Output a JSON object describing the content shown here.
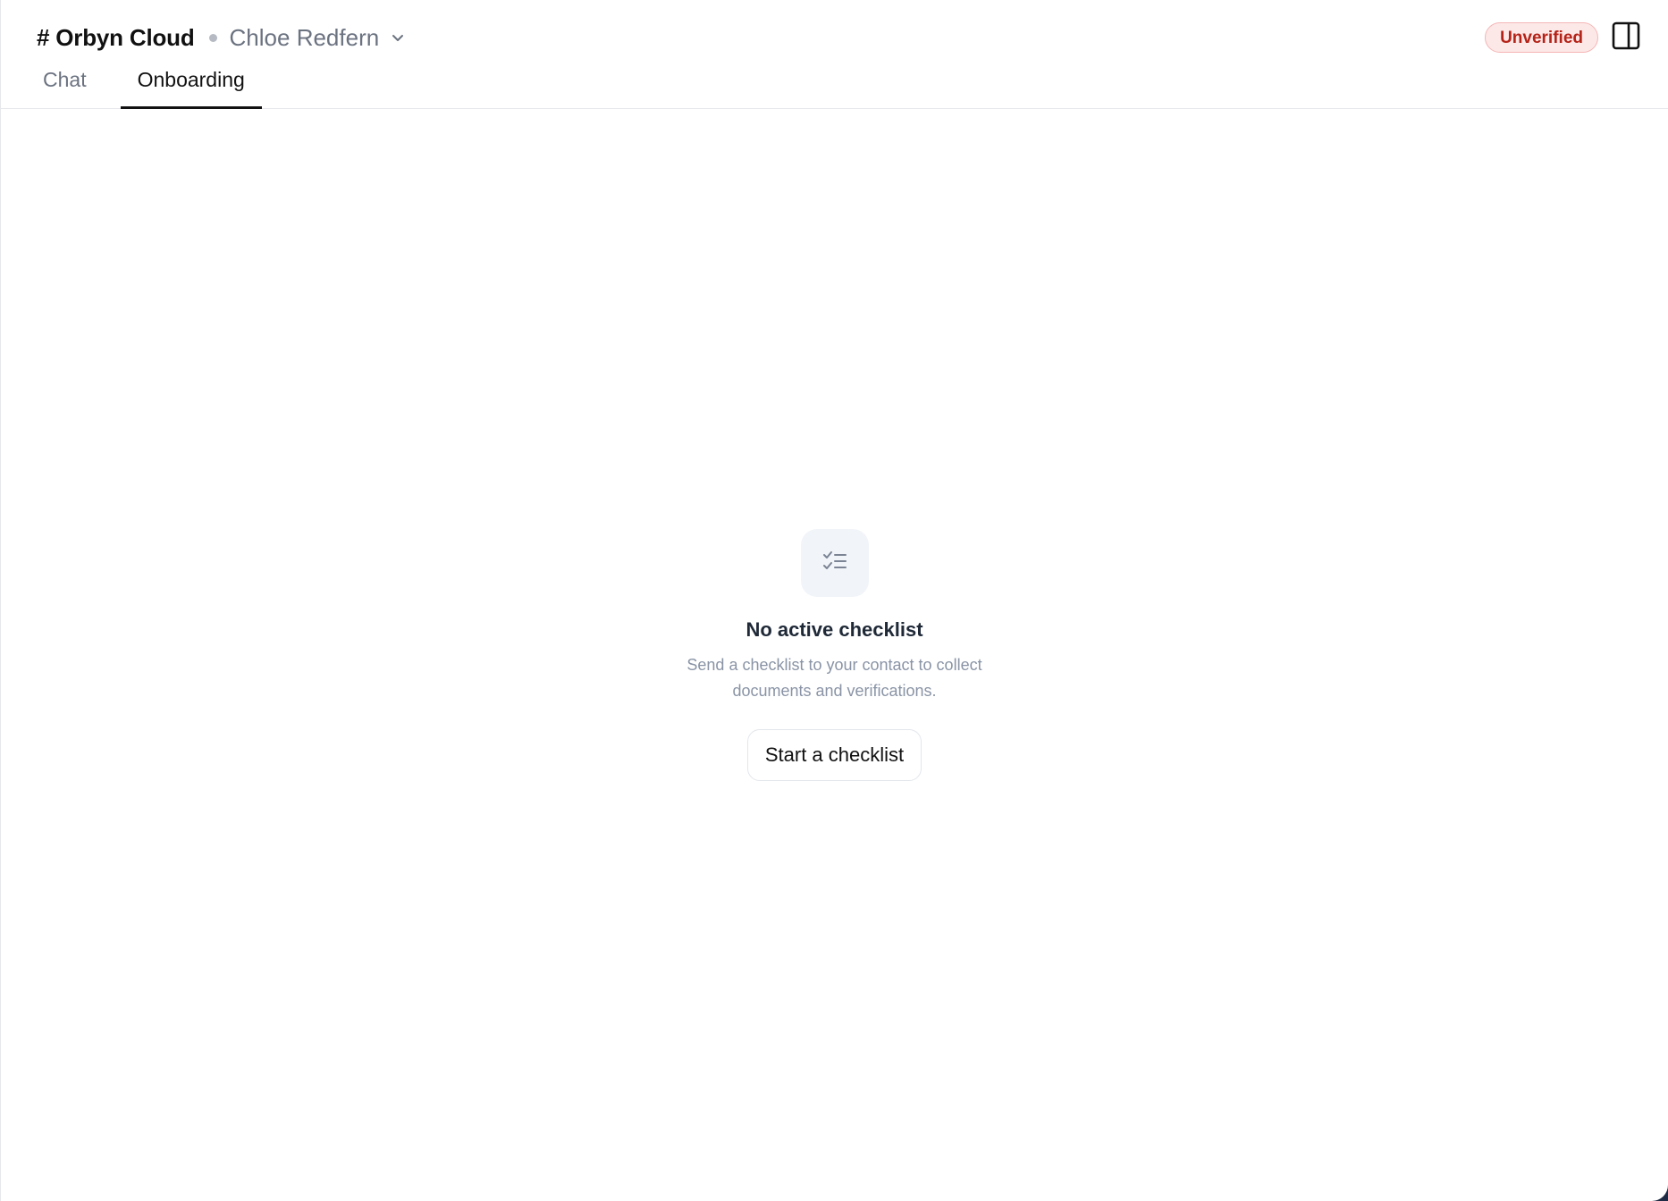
{
  "header": {
    "channel_name": "# Orbyn Cloud",
    "contact_name": "Chloe Redfern",
    "status_badge": "Unverified",
    "tabs": [
      {
        "label": "Chat",
        "active": false
      },
      {
        "label": "Onboarding",
        "active": true
      }
    ]
  },
  "empty_state": {
    "icon": "checklist-icon",
    "title": "No active checklist",
    "description": "Send a checklist to your contact to collect documents and verifications.",
    "button_label": "Start a checklist"
  },
  "colors": {
    "badge_bg": "#fde8e8",
    "badge_text": "#b42318",
    "active_tab": "#111111",
    "muted_text": "#8a94a6"
  }
}
